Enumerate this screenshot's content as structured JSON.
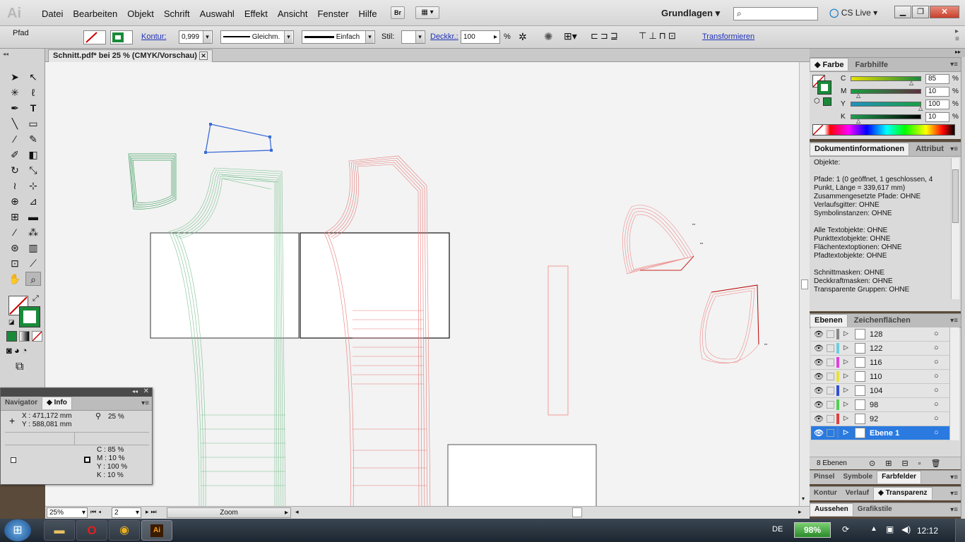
{
  "app": {
    "logo": "Ai"
  },
  "menu": [
    "Datei",
    "Bearbeiten",
    "Objekt",
    "Schrift",
    "Auswahl",
    "Effekt",
    "Ansicht",
    "Fenster",
    "Hilfe"
  ],
  "bridge_label": "Br",
  "workspace": "Grundlagen",
  "cslive": "CS Live",
  "control": {
    "selection": "Pfad",
    "kontur_label": "Kontur:",
    "kontur_value": "0,999",
    "stroke_profile": "Gleichm.",
    "brush": "Einfach",
    "stil_label": "Stil:",
    "deckkr_label": "Deckkr.:",
    "deckkr_value": "100",
    "percent": "%",
    "transform_link": "Transformieren"
  },
  "document_tab": "Schnitt.pdf* bei 25 % (CMYK/Vorschau)",
  "color_panel": {
    "tabs": [
      "Farbe",
      "Farbhilfe"
    ],
    "channels": [
      {
        "name": "C",
        "value": "85",
        "color": "#00a0c8"
      },
      {
        "name": "M",
        "value": "10",
        "color": "#c0208a"
      },
      {
        "name": "Y",
        "value": "100",
        "color": "#d8c800"
      },
      {
        "name": "K",
        "value": "10",
        "color": "#222222"
      }
    ],
    "unit": "%"
  },
  "docinfo": {
    "tabs": [
      "Dokumentinformationen",
      "Attribut"
    ],
    "lines": [
      "Objekte:",
      "",
      "Pfade: 1 (0 geöffnet, 1 geschlossen, 4",
      "Punkt, Länge = 339,617 mm)",
      "Zusammengesetzte Pfade: OHNE",
      "Verlaufsgitter: OHNE",
      "Symbolinstanzen: OHNE",
      "",
      "Alle Textobjekte: OHNE",
      "Punkttextobjekte: OHNE",
      "Flächentextoptionen: OHNE",
      "Pfadtextobjekte: OHNE",
      "",
      "Schnittmasken: OHNE",
      "Deckkraftmasken: OHNE",
      "Transparente Gruppen: OHNE"
    ]
  },
  "layers": {
    "tabs": [
      "Ebenen",
      "Zeichenflächen"
    ],
    "rows": [
      {
        "name": "128",
        "color": "#888888"
      },
      {
        "name": "122",
        "color": "#6ad0e0"
      },
      {
        "name": "116",
        "color": "#e040e0"
      },
      {
        "name": "110",
        "color": "#e8e040"
      },
      {
        "name": "104",
        "color": "#3050d0"
      },
      {
        "name": "98",
        "color": "#50d050"
      },
      {
        "name": "92",
        "color": "#e04040"
      },
      {
        "name": "Ebene 1",
        "color": "#4080e0"
      }
    ],
    "count": "8 Ebenen"
  },
  "bottom_panels": [
    {
      "tabs": [
        "Pinsel",
        "Symbole",
        "Farbfelder"
      ],
      "active": 2
    },
    {
      "tabs": [
        "Kontur",
        "Verlauf",
        "Transparenz"
      ],
      "active": 2
    },
    {
      "tabs": [
        "Aussehen",
        "Grafikstile"
      ],
      "active": 0
    }
  ],
  "info_panel": {
    "tabs": [
      "Navigator",
      "Info"
    ],
    "x_label": "X",
    "x_value": ": 471,172 mm",
    "y_label": "Y",
    "y_value": ": 588,081 mm",
    "zoom": "25 %",
    "cmyk": [
      {
        "k": "C",
        "v": ": 85 %"
      },
      {
        "k": "M",
        "v": ": 10 %"
      },
      {
        "k": "Y",
        "v": ": 100 %"
      },
      {
        "k": "K",
        "v": ": 10 %"
      }
    ]
  },
  "statusbar": {
    "zoom": "25%",
    "page": "2",
    "mode": "Zoom"
  },
  "taskbar": {
    "lang": "DE",
    "battery": "98%",
    "time": "12:12"
  }
}
